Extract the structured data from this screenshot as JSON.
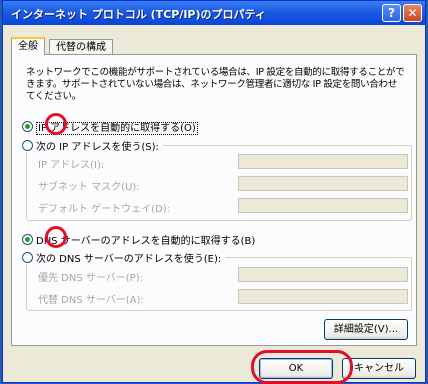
{
  "window": {
    "title": "インターネット プロトコル (TCP/IP)のプロパティ",
    "help_glyph": "?",
    "close_glyph": "✕"
  },
  "tabs": [
    {
      "label": "全般"
    },
    {
      "label": "代替の構成"
    }
  ],
  "description": "ネットワークでこの機能がサポートされている場合は、IP 設定を自動的に取得することができます。サポートされていない場合は、ネットワーク管理者に適切な IP 設定を問い合わせてください。",
  "ip": {
    "auto_label": "IP アドレスを自動的に取得する(O)",
    "manual_label": "次の IP アドレスを使う(S):",
    "selected": "auto",
    "fields": [
      {
        "label": "IP アドレス(I):",
        "value": ""
      },
      {
        "label": "サブネット マスク(U):",
        "value": ""
      },
      {
        "label": "デフォルト ゲートウェイ(D):",
        "value": ""
      }
    ]
  },
  "dns": {
    "auto_label": "DNS サーバーのアドレスを自動的に取得する(B)",
    "manual_label": "次の DNS サーバーのアドレスを使う(E):",
    "selected": "auto",
    "fields": [
      {
        "label": "優先 DNS サーバー(P):",
        "value": ""
      },
      {
        "label": "代替 DNS サーバー(A):",
        "value": ""
      }
    ]
  },
  "buttons": {
    "advanced": "詳細設定(V)...",
    "ok": "OK",
    "cancel": "キャンセル"
  },
  "colors": {
    "highlight": "#e0102a",
    "titlebar": "#0a46d6",
    "radio_dot": "#21a121"
  }
}
